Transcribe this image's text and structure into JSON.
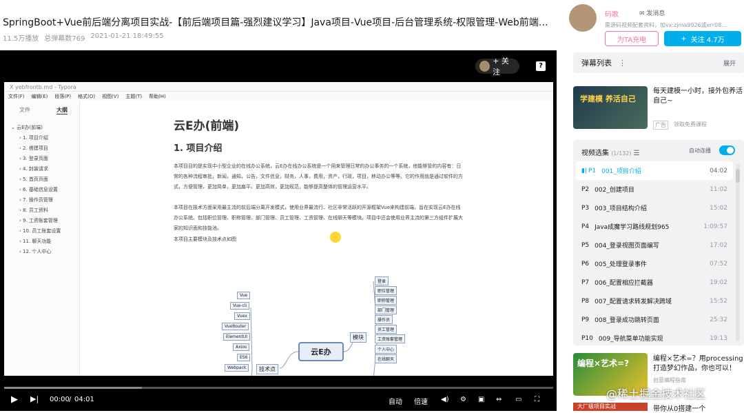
{
  "video": {
    "title": "SpringBoot+Vue前后端分离项目实战-【前后端项目篇-强烈建议学习】Java项目-Vue项目-后台管理系统-权限管理-Web前端项目...",
    "plays": "11.5万播放",
    "danmaku": "总弹幕数769",
    "date": "2021-01-21 18:49:55"
  },
  "player": {
    "follow_label": "+ 关注",
    "help": "?",
    "time_current": "00:00",
    "time_sep": "/",
    "time_total": "04:01",
    "auto_label": "自动",
    "speed_label": "倍速"
  },
  "typora": {
    "window_title": "X  yebfrontb.md - Typora",
    "menu": [
      "文件(F)",
      "编辑(E)",
      "段落(P)",
      "格式(O)",
      "视图(V)",
      "主题(T)",
      "帮助(H)"
    ],
    "tab_files": "文件",
    "tab_outline": "大纲",
    "outline_root": "云E办(前端)",
    "outline": [
      "1. 项目介绍",
      "2. 搭建项目",
      "3. 登录页面",
      "4. 封装请求",
      "5. 首页页面",
      "6. 基础信息设置",
      "7. 操作员管理",
      "8. 员工资料",
      "9. 工资账套管理",
      "10. 员工账套设置",
      "11. 聊天功能",
      "12. 个人中心"
    ],
    "h1": "云E办(前端)",
    "h2": "1. 项目介绍",
    "p1": "本项目目的是实现中小型企业的在线办公系统，云E办在线办公系统是一个用来管理日常的办公事务的一个系统，他能够管的内容有：日常的各种流程审批，新闻，通知，公告，文件信息，财务，人事，费用，资产，行政，项目，移动办公等等。它的作用就是通过软件的方式，方便管理，更加简单，更加扁平。更加高效，更加规范，能够提高整体的管理运营水平。",
    "p2": "本项目在技术方面采用最主流的前后端分离开发模式，使用业界最流行、社区非常活跃的开源框架Vue来构建前端，旨在实现云E办在线办公系统。包括职位管理、职称管理、部门管理、员工管理、工资管理、在线聊天等模块。项目中还会使用业界主流的第三方组件扩展大家的知识面和技能池。",
    "p3": "本项目主要模块及技术点如图",
    "mm_center": "云E办",
    "mm_tech": "技术点",
    "mm_module": "模块",
    "mm_tech_items": [
      "Vue",
      "Vue-cli",
      "Vuex",
      "VueRouter",
      "ElementUI",
      "Axios",
      "ES6",
      "Webpack"
    ],
    "mm_module_items": [
      "登录",
      "职位管理",
      "职称管理",
      "部门管理",
      "操作员",
      "员工管理",
      "工资账套管理",
      "个人中心",
      "在线聊天"
    ]
  },
  "uploader": {
    "name": "码歌",
    "msg_label": "发消息",
    "desc": "需源码视频配套资料，加vx:zjma9926或err08...",
    "charge_label": "为TA充电",
    "follow_label": "关注 4.7万"
  },
  "danmu_list": {
    "label": "弹幕列表",
    "expand": "展开"
  },
  "ad": {
    "img_text": "学建模 养活自己",
    "title": "每天建模一小时，接外包养活自己~",
    "badge": "广告",
    "link": "领取免费课程"
  },
  "playlist": {
    "label": "视频选集",
    "count": "(1/132)",
    "autoplay_label": "自动连播",
    "items": [
      {
        "p": "P1",
        "title": "001_项目介绍",
        "dur": "04:02"
      },
      {
        "p": "P2",
        "title": "002_创建项目",
        "dur": "11:02"
      },
      {
        "p": "P3",
        "title": "003_项目结构介绍",
        "dur": "15:02"
      },
      {
        "p": "P4",
        "title": "Java成魔学习路线规划965",
        "dur": "1:09:57"
      },
      {
        "p": "P5",
        "title": "004_登录视图页面编写",
        "dur": "17:02"
      },
      {
        "p": "P6",
        "title": "005_处理登录事件",
        "dur": "07:52"
      },
      {
        "p": "P7",
        "title": "006_配置相应拦截器",
        "dur": "19:02"
      },
      {
        "p": "P8",
        "title": "007_配置请求转发解决跨域",
        "dur": "15:52"
      },
      {
        "p": "P9",
        "title": "008_登录成功跳转页面",
        "dur": "25:32"
      },
      {
        "p": "P10",
        "title": "009_导航菜单功能实现",
        "dur": "19:13"
      }
    ]
  },
  "rec": {
    "img_text": "编程×艺术=?",
    "title": "编程×艺术=？用processing打造梦幻作品，你也可以！",
    "sub": "创意编程指南",
    "img2_text": "大厂级项目实战",
    "title2": "带你从0搭建一个"
  },
  "watermark": "@稀土掘金技术社区",
  "colors": {
    "accent": "#00aeec",
    "pink": "#fb7299"
  }
}
